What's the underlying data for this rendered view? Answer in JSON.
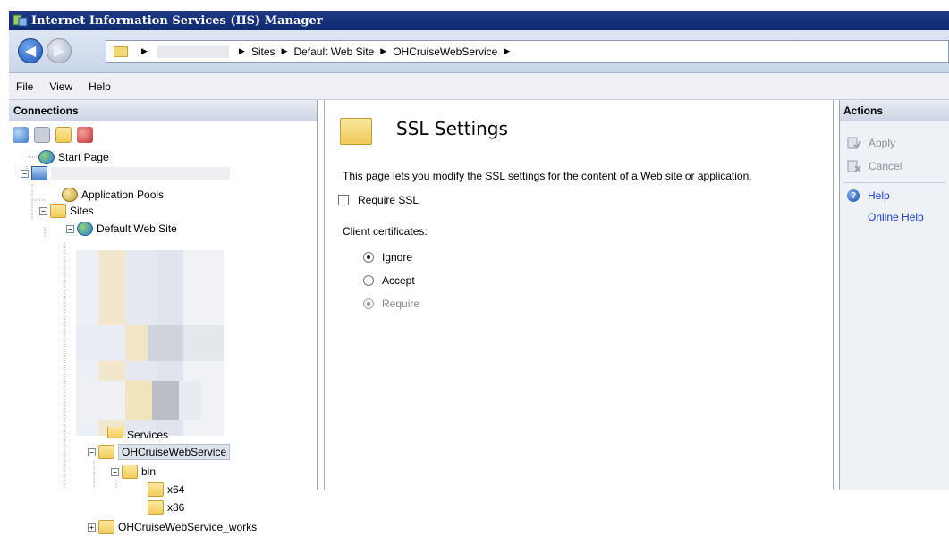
{
  "window": {
    "title": "Internet Information Services (IIS) Manager"
  },
  "address": {
    "crumbs": [
      "Sites",
      "Default Web Site",
      "OHCruiseWebService"
    ]
  },
  "menu": {
    "items": [
      "File",
      "View",
      "Help"
    ]
  },
  "connections": {
    "header": "Connections",
    "tree": {
      "start_page": "Start Page",
      "app_pools": "Application Pools",
      "sites": "Sites",
      "default_site": "Default Web Site",
      "partial_hidden": "Services",
      "selected": "OHCruiseWebService",
      "bin": "bin",
      "x64": "x64",
      "x86": "x86",
      "works": "OHCruiseWebService_works"
    }
  },
  "content": {
    "title": "SSL Settings",
    "description": "This page lets you modify the SSL settings for the content of a Web site or application.",
    "require_ssl_label": "Require SSL",
    "require_ssl_checked": false,
    "client_certs_label": "Client certificates:",
    "options": [
      {
        "label": "Ignore",
        "checked": true,
        "disabled": false
      },
      {
        "label": "Accept",
        "checked": false,
        "disabled": false
      },
      {
        "label": "Require",
        "checked": true,
        "disabled": true
      }
    ]
  },
  "actions": {
    "header": "Actions",
    "apply": "Apply",
    "cancel": "Cancel",
    "help": "Help",
    "online_help": "Online Help"
  }
}
